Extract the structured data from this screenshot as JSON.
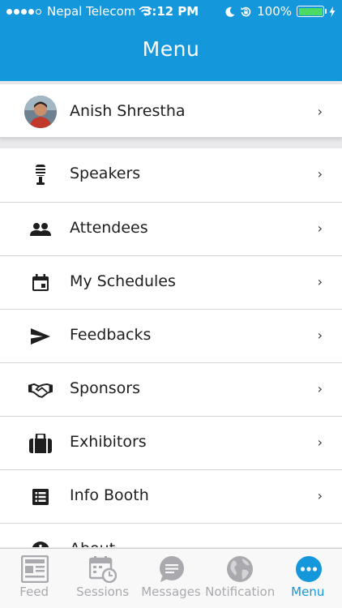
{
  "status_bar": {
    "carrier": "Nepal Telecom",
    "time": "3:12 PM",
    "battery": "100%"
  },
  "header": {
    "title": "Menu"
  },
  "profile": {
    "name": "Anish Shrestha"
  },
  "menu": {
    "items": [
      {
        "label": "Speakers",
        "icon": "microphone-icon"
      },
      {
        "label": "Attendees",
        "icon": "people-icon"
      },
      {
        "label": "My Schedules",
        "icon": "calendar-icon"
      },
      {
        "label": "Feedbacks",
        "icon": "send-icon"
      },
      {
        "label": "Sponsors",
        "icon": "handshake-icon"
      },
      {
        "label": "Exhibitors",
        "icon": "briefcase-icon"
      },
      {
        "label": "Info Booth",
        "icon": "list-icon"
      },
      {
        "label": "About",
        "icon": "info-icon"
      }
    ]
  },
  "tabbar": {
    "tabs": [
      {
        "label": "Feed",
        "icon": "newspaper-icon",
        "active": false
      },
      {
        "label": "Sessions",
        "icon": "calendar-clock-icon",
        "active": false
      },
      {
        "label": "Messages",
        "icon": "chat-bubble-icon",
        "active": false
      },
      {
        "label": "Notification",
        "icon": "globe-icon",
        "active": false
      },
      {
        "label": "Menu",
        "icon": "more-dots-icon",
        "active": true
      }
    ]
  },
  "colors": {
    "accent": "#1597dc",
    "battery": "#4cd964",
    "inactive": "#a9a9ae"
  }
}
